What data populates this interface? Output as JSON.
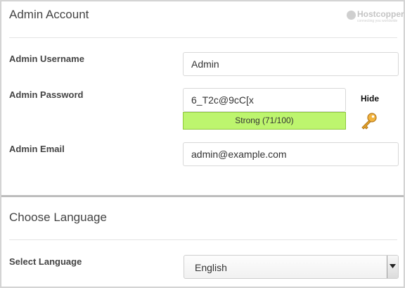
{
  "admin_account": {
    "title": "Admin Account",
    "logo": {
      "name": "Hostcopper",
      "tagline": "connecting you worldwide"
    },
    "username": {
      "label": "Admin Username",
      "value": "Admin"
    },
    "password": {
      "label": "Admin Password",
      "value": "6_T2c@9cC[x",
      "hide_label": "Hide",
      "strength_text": "Strong (71/100)"
    },
    "email": {
      "label": "Admin Email",
      "value": "admin@example.com"
    }
  },
  "language": {
    "title": "Choose Language",
    "select": {
      "label": "Select Language",
      "value": "English"
    }
  },
  "colors": {
    "strength_fill": "#bdf56e",
    "strength_border": "#8fc93a",
    "key": "#e0a12a"
  },
  "icons": [
    "hostcopper-logo-icon",
    "key-icon",
    "dropdown-arrow-icon"
  ]
}
